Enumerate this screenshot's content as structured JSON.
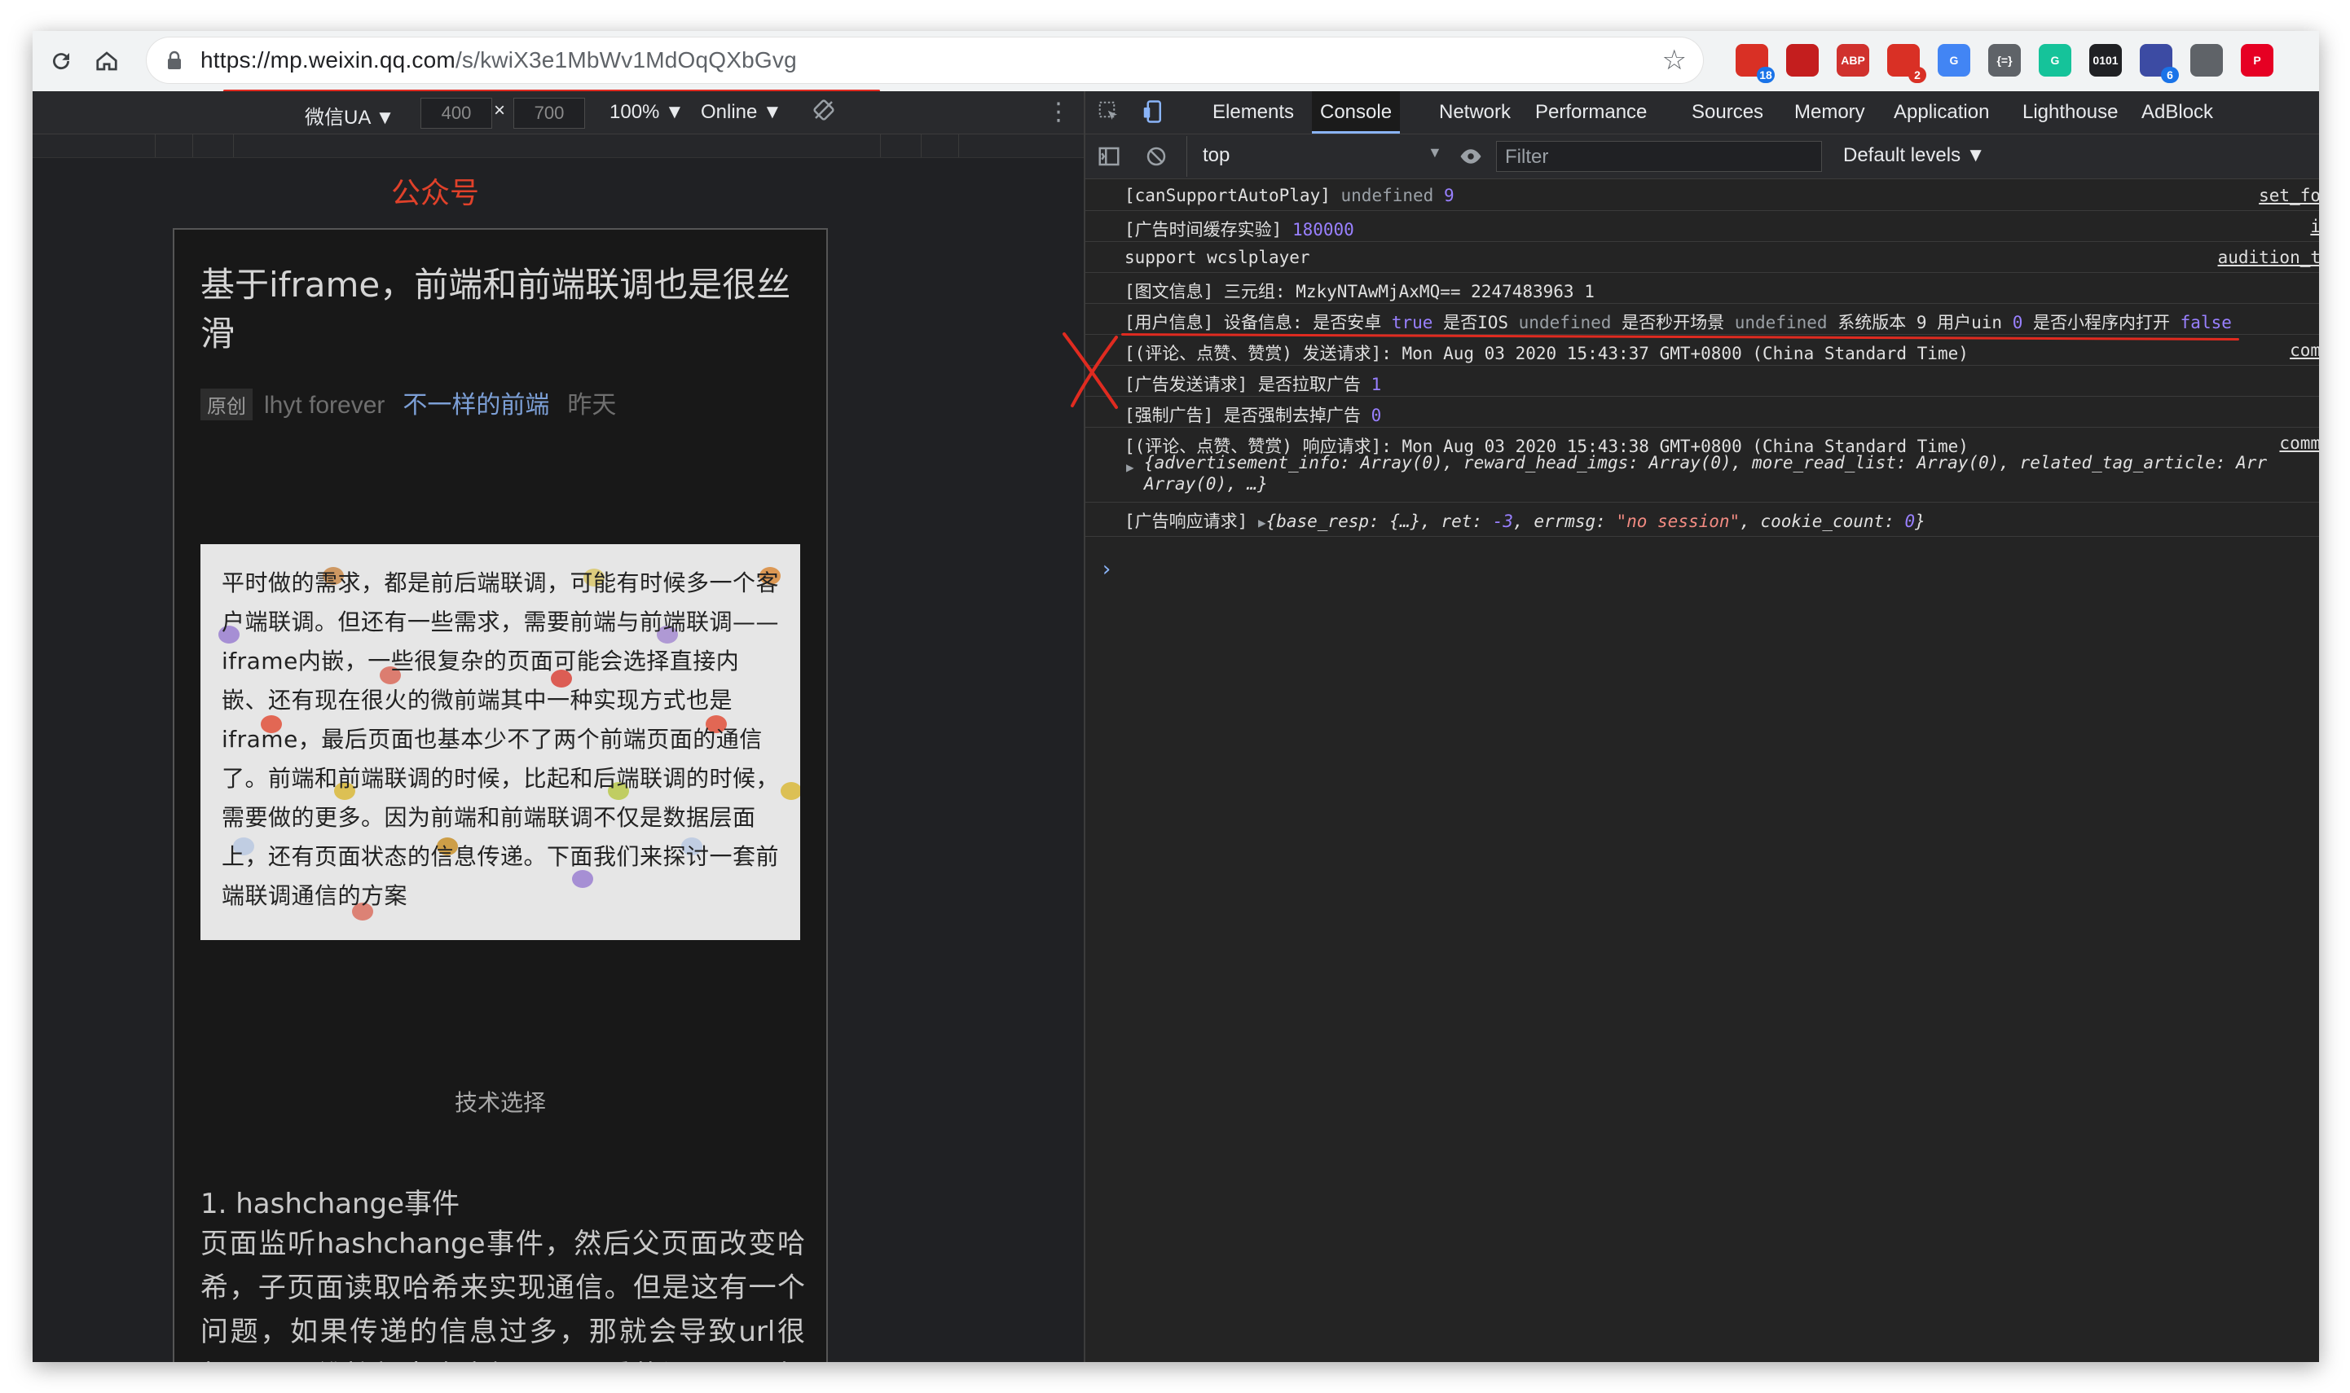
{
  "browser": {
    "url_host": "https://mp.weixin.qq.com",
    "url_path": "/s/kwiX3e1MbWv1MdOqQXbGvg",
    "extensions": [
      {
        "name": "google-icon",
        "badge": "18",
        "color": "#d93025",
        "badge_color": "#1a73e8"
      },
      {
        "name": "ublock-icon",
        "badge": "",
        "color": "#c41e1e",
        "badge_color": ""
      },
      {
        "name": "adblock-plus-icon",
        "badge": "",
        "color": "#d0312d",
        "badge_color": "",
        "label": "ABP"
      },
      {
        "name": "gmail-icon",
        "badge": "2",
        "color": "#d93025",
        "badge_color": "#d93025"
      },
      {
        "name": "translate-icon",
        "badge": "",
        "color": "#4285f4",
        "badge_color": "",
        "label": "G"
      },
      {
        "name": "json-icon",
        "badge": "",
        "color": "#5f6368",
        "badge_color": "",
        "label": "{=}"
      },
      {
        "name": "grammarly-icon",
        "badge": "",
        "color": "#15c39a",
        "badge_color": "",
        "label": "G"
      },
      {
        "name": "binary-icon",
        "badge": "",
        "color": "#202124",
        "badge_color": "",
        "label": "0101"
      },
      {
        "name": "graduation-cap-icon",
        "badge": "6",
        "color": "#3c4ba3",
        "badge_color": "#1a73e8"
      },
      {
        "name": "qr-code-icon",
        "badge": "",
        "color": "#5f6368",
        "badge_color": ""
      },
      {
        "name": "pinterest-icon",
        "badge": "",
        "color": "#e60023",
        "badge_color": "",
        "label": "P"
      }
    ]
  },
  "device_toolbar": {
    "ua": "微信UA ▼",
    "width": "400",
    "times": "×",
    "height": "700",
    "zoom": "100% ▼",
    "network": "Online ▼"
  },
  "annotation": {
    "label": "公众号",
    "color": "#e02b20"
  },
  "article": {
    "title": "基于iframe，前端和前端联调也是很丝滑",
    "badge": "原创",
    "author": "lhyt forever",
    "account": "不一样的前端",
    "date": "昨天",
    "quote": "平时做的需求，都是前后端联调，可能有时候多一个客户端联调。但还有一些需求，需要前端与前端联调——iframe内嵌，一些很复杂的页面可能会选择直接内嵌、还有现在很火的微前端其中一种实现方式也是iframe，最后页面也基本少不了两个前端页面的通信了。前端和前端联调的时候，比起和后端联调的时候，需要做的更多。因为前端和前端联调不仅是数据层面上，还有页面状态的信息传递。下面我们来探讨一套前端联调通信的方案",
    "section": "技术选择",
    "heading": "1. hashchange事件",
    "paragraph": "页面监听hashchange事件，然后父页面改变哈希，子页面读取哈希来实现通信。但是这有一个问题，如果传递的信息过多，那就会导致url很长，而且维护起来也麻烦。更严重的问题是，如果页面本身有利用哈希的逻辑，将会无"
  },
  "devtools": {
    "tabs": [
      "Elements",
      "Console",
      "Network",
      "Performance",
      "Sources",
      "Memory",
      "Application",
      "Lighthouse",
      "AdBlock"
    ],
    "active_tab": "Console",
    "context": "top",
    "filter_placeholder": "Filter",
    "levels": "Default levels ▼"
  },
  "console": {
    "rows": [
      {
        "text": "[canSupportAutoPlay] undefined 9",
        "source": "set_fo"
      },
      {
        "text": "[广告时间缓存实验] 180000",
        "source": "i"
      },
      {
        "text": "support wcslplayer",
        "source": "audition_t"
      },
      {
        "text": "[图文信息] 三元组: MzkyNTAwMjAxMQ== 2247483963 1",
        "source": ""
      },
      {
        "text": "[用户信息] 设备信息: 是否安卓 true 是否IOS undefined 是否秒开场景 undefined 系统版本 9 用户uin 0 是否小程序内打开 false",
        "source": ""
      },
      {
        "text": "[(评论、点赞、赞赏) 发送请求]:  Mon Aug 03 2020 15:43:37 GMT+0800 (China Standard Time)",
        "source": "com"
      },
      {
        "text": "[广告发送请求] 是否拉取广告 1",
        "source": ""
      },
      {
        "text": "[强制广告] 是否强制去掉广告 0",
        "source": ""
      },
      {
        "text": "[(评论、点赞、赞赏) 响应请求]:  Mon Aug 03 2020 15:43:38 GMT+0800 (China Standard Time)",
        "source": "comm"
      },
      {
        "text": "{advertisement_info: Array(0), reward_head_imgs: Array(0), more_read_list: Array(0), related_tag_article: Arr",
        "source": ""
      },
      {
        "text": "Array(0), …}",
        "source": ""
      },
      {
        "text": "[广告响应请求]  {base_resp: {…}, ret: -3, errmsg: \"no session\", cookie_count: 0}",
        "source": ""
      }
    ],
    "prompt": "›"
  }
}
